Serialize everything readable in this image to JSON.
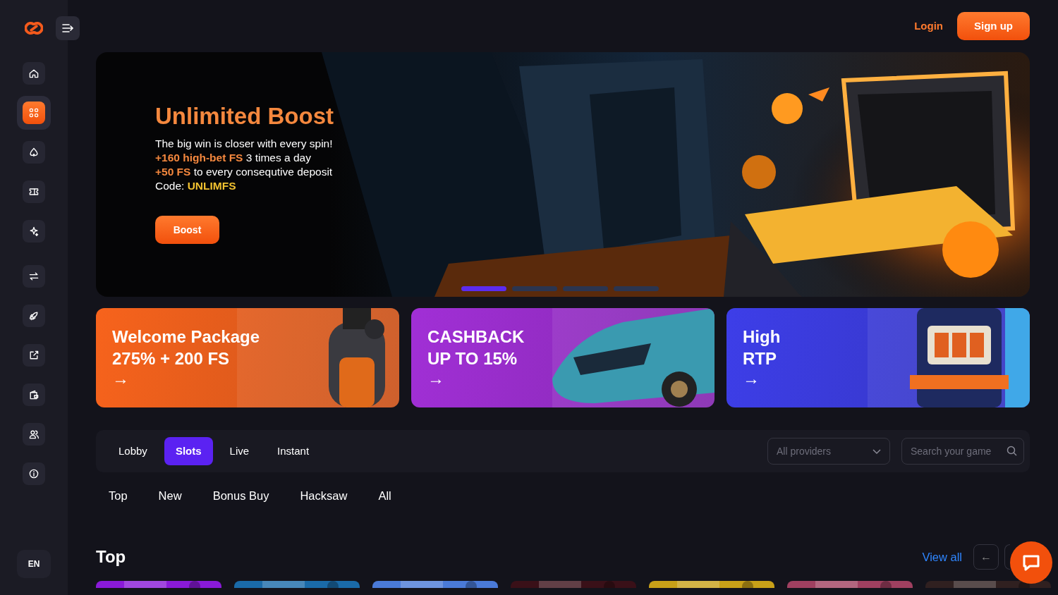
{
  "header": {
    "login": "Login",
    "signup": "Sign up"
  },
  "sidebar": {
    "items": [
      {
        "selected": false
      },
      {
        "selected": true
      },
      {
        "selected": false
      },
      {
        "selected": false
      },
      {
        "selected": false
      },
      {
        "selected": false
      },
      {
        "selected": false
      },
      {
        "selected": false
      },
      {
        "selected": false
      },
      {
        "selected": false
      },
      {
        "selected": false
      }
    ],
    "language": "EN"
  },
  "hero": {
    "title": "Unlimited Boost",
    "lines": [
      {
        "kind": "text",
        "text": "The big win is closer with every spin!"
      },
      {
        "kind": "text",
        "text": "**+160 high-bet FS** 3 times a day"
      },
      {
        "kind": "text",
        "text": "**+50 FS** to every consequtive deposit"
      },
      {
        "kind": "code",
        "text": "Code: **UNLIMFS**"
      }
    ],
    "button": "Boost",
    "dots": [
      {
        "selected": true
      },
      {
        "selected": false
      },
      {
        "selected": false
      },
      {
        "selected": false
      }
    ]
  },
  "promos": [
    {
      "lines": [
        "Welcome Package",
        "275% + 200 FS"
      ],
      "arrow": "→",
      "color": "#f7631c"
    },
    {
      "lines": [
        "CASHBACK",
        "UP TO 15%"
      ],
      "arrow": "→",
      "color": "#a12fd6"
    },
    {
      "lines": [
        "High",
        "RTP"
      ],
      "arrow": "→",
      "color": "#3d3ee8"
    }
  ],
  "tabs": [
    {
      "label": "Lobby",
      "selected": false
    },
    {
      "label": "Slots",
      "selected": true
    },
    {
      "label": "Live",
      "selected": false
    },
    {
      "label": "Instant",
      "selected": false
    }
  ],
  "providers": {
    "value": "All providers"
  },
  "search": {
    "placeholder": "Search your game"
  },
  "categories": [
    "Top",
    "New",
    "Bonus Buy",
    "Hacksaw",
    "All"
  ],
  "section": {
    "title": "Top",
    "view_all": "View all",
    "prev": "←"
  }
}
